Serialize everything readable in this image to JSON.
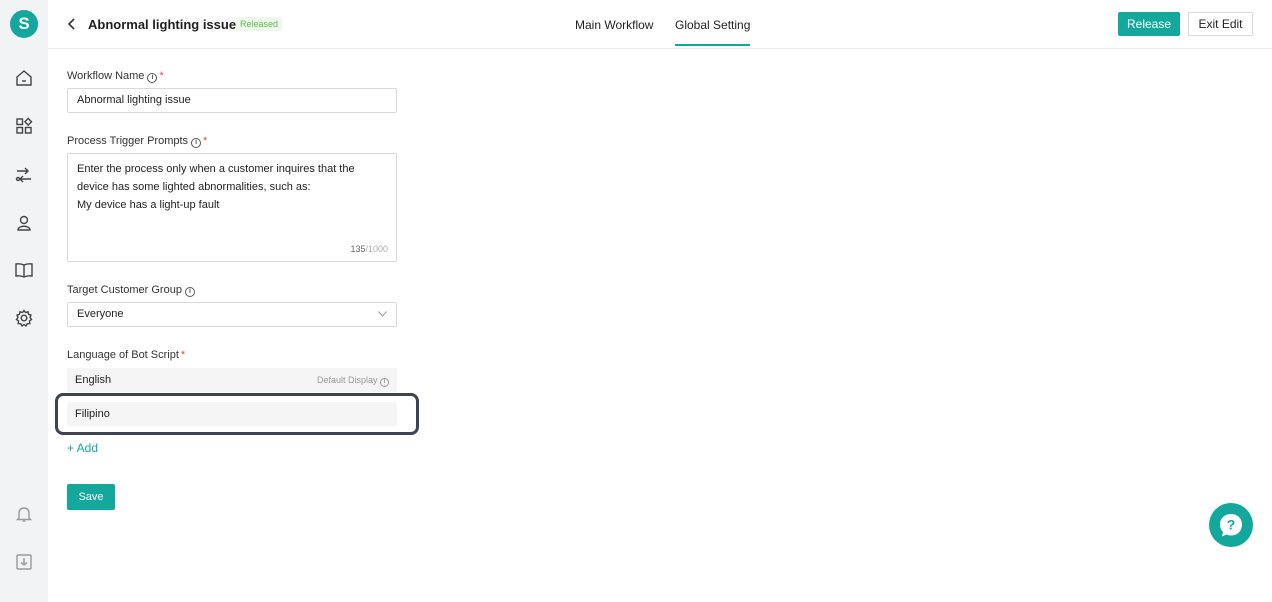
{
  "app": {
    "logo_letter": "S"
  },
  "header": {
    "title": "Abnormal lighting issue",
    "status_badge": "Released",
    "tabs": [
      {
        "label": "Main Workflow",
        "active": false
      },
      {
        "label": "Global Setting",
        "active": true
      }
    ],
    "release_label": "Release",
    "exit_label": "Exit Edit"
  },
  "form": {
    "workflow_name": {
      "label": "Workflow Name",
      "value": "Abnormal lighting issue"
    },
    "trigger_prompts": {
      "label": "Process Trigger Prompts",
      "lines": [
        "Enter the process only when a customer inquires that the",
        "device has some lighted abnormalities, such as:",
        "My device has a light-up fault"
      ],
      "count": "135",
      "max": "/1000"
    },
    "target_group": {
      "label": "Target Customer Group",
      "value": "Everyone"
    },
    "language": {
      "label": "Language of Bot Script",
      "items": [
        {
          "name": "English",
          "note": "Default Display"
        },
        {
          "name": "Filipino",
          "note": ""
        }
      ],
      "add_label": "+ Add"
    },
    "save_label": "Save"
  },
  "icons": {
    "sidebar": [
      "home-icon",
      "apps-icon",
      "workflow-icon",
      "user-icon",
      "book-icon",
      "settings-icon",
      "bell-icon",
      "download-icon"
    ],
    "help": "help-bubble-icon"
  },
  "colors": {
    "accent": "#14a89c",
    "required": "#e5484d",
    "badge_text": "#5bbf4f"
  }
}
